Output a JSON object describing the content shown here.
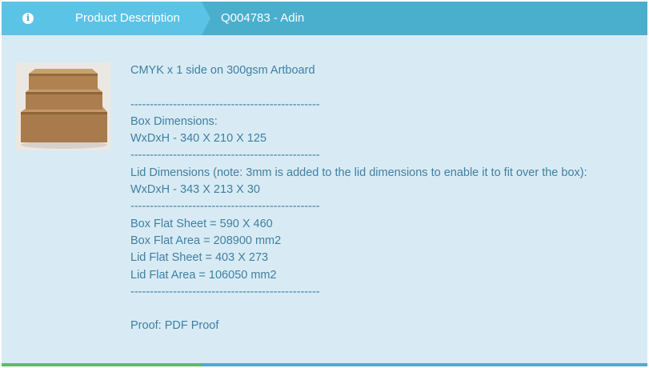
{
  "header": {
    "info_icon": "info-circle-icon",
    "tab_label": "Product Description",
    "quote_label": "Q004783 - Adin"
  },
  "product": {
    "image": "stacked-cardboard-boxes",
    "description_lines": [
      "CMYK x 1 side  on 300gsm Artboard",
      "",
      "-------------------------------------------------",
      "Box Dimensions:",
      "WxDxH - 340 X 210 X 125",
      "-------------------------------------------------",
      "Lid Dimensions (note: 3mm is added to the lid dimensions to enable it to fit over the box):",
      "WxDxH - 343 X 213 X 30",
      "-------------------------------------------------",
      "Box Flat Sheet = 590 X 460",
      "Box Flat Area = 208900 mm2",
      "Lid Flat Sheet = 403 X 273",
      "Lid Flat Area = 106050 mm2",
      "-------------------------------------------------",
      "",
      "Proof: PDF Proof"
    ]
  },
  "footer": {
    "progress_fraction": 0.31,
    "progress_color": "#5cbd60",
    "track_color": "#4aaecd"
  }
}
